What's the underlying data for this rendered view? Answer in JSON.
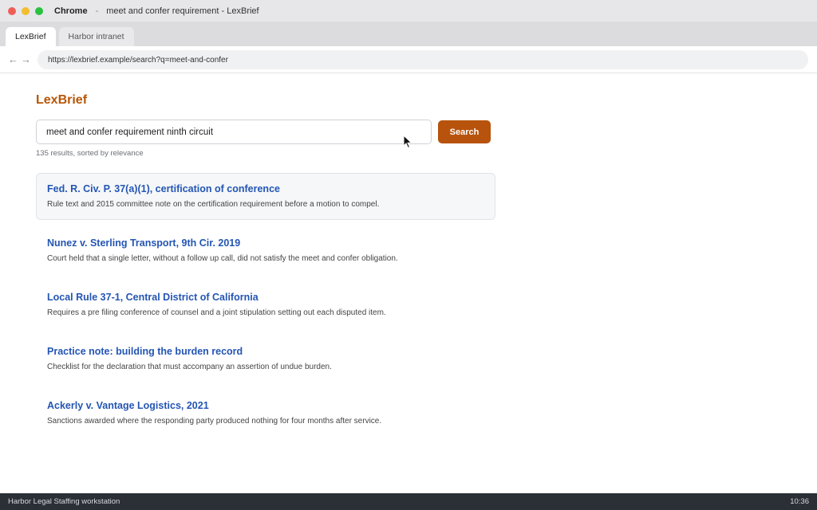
{
  "window": {
    "app_name": "Chrome",
    "separator": "-",
    "title": "meet and confer requirement - LexBrief"
  },
  "tabs": [
    {
      "label": "LexBrief",
      "active": true
    },
    {
      "label": "Harbor intranet",
      "active": false
    }
  ],
  "nav": {
    "back_icon": "←",
    "forward_icon": "→",
    "url": "https://lexbrief.example/search?q=meet-and-confer"
  },
  "page": {
    "logo": "LexBrief",
    "search": {
      "value": "meet and confer requirement ninth circuit",
      "button_label": "Search"
    },
    "result_count": "135 results, sorted by relevance",
    "results": [
      {
        "title": "Fed. R. Civ. P. 37(a)(1), certification of conference",
        "snippet": "Rule text and 2015 committee note on the certification requirement before a motion to compel."
      },
      {
        "title": "Nunez v. Sterling Transport, 9th Cir. 2019",
        "snippet": "Court held that a single letter, without a follow up call, did not satisfy the meet and confer obligation."
      },
      {
        "title": "Local Rule 37-1, Central District of California",
        "snippet": "Requires a pre filing conference of counsel and a joint stipulation setting out each disputed item."
      },
      {
        "title": "Practice note: building the burden record",
        "snippet": "Checklist for the declaration that must accompany an assertion of undue burden."
      },
      {
        "title": "Ackerly v. Vantage Logistics, 2021",
        "snippet": "Sanctions awarded where the responding party produced nothing for four months after service."
      }
    ]
  },
  "statusbar": {
    "left": "Harbor Legal Staffing workstation",
    "right": "10:36"
  },
  "colors": {
    "brand": "#b85607",
    "button": "#b7530c",
    "link": "#2455b3",
    "statusbar": "#2b2f36"
  }
}
